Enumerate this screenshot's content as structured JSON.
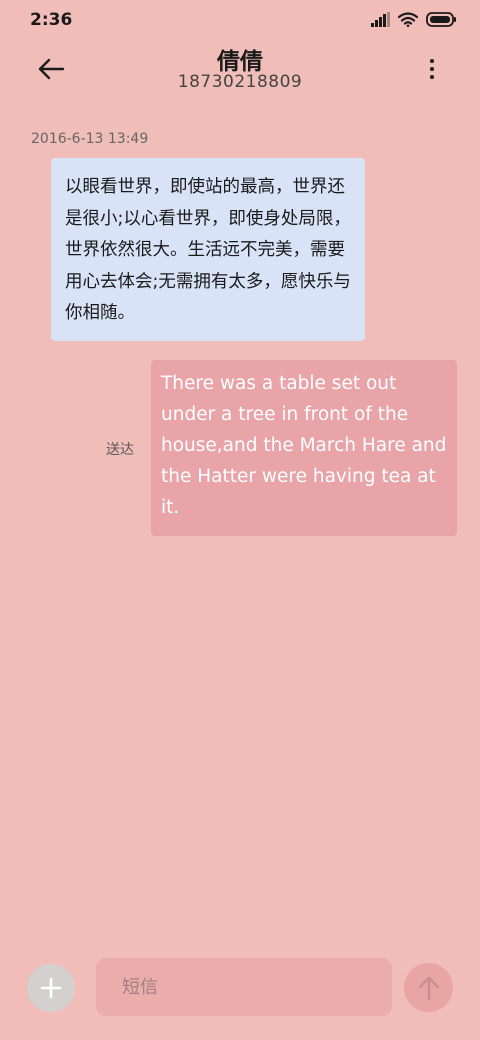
{
  "status_bar": {
    "time": "2:36",
    "icons": [
      "signal-icon",
      "wifi-icon",
      "battery-icon"
    ]
  },
  "header": {
    "back_icon": "arrow-left-icon",
    "contact_name": "倩倩",
    "contact_number": "18730218809",
    "menu_icon": "more-vertical-icon"
  },
  "conversation": {
    "timestamp": "2016-6-13 13:49",
    "messages": [
      {
        "direction": "incoming",
        "text": "以眼看世界，即使站的最高，世界还是很小;以心看世界，即使身处局限，世界依然很大。生活远不完美，需要用心去体会;无需拥有太多，愿快乐与你相随。"
      },
      {
        "direction": "outgoing",
        "text": "There was a table set out under a tree in front of the house,and the March Hare and the Hatter were having tea at it.",
        "status": "送达"
      }
    ]
  },
  "input_bar": {
    "add_icon": "plus-icon",
    "placeholder": "短信",
    "value": "",
    "send_icon": "arrow-up-icon"
  },
  "colors": {
    "background": "#f0bdb9",
    "incoming_bubble": "#d9e3f8",
    "outgoing_bubble": "#e8a4a8",
    "input_field": "#eaadab",
    "send_button": "#e8a5a4",
    "add_button": "#d4d0d0"
  }
}
